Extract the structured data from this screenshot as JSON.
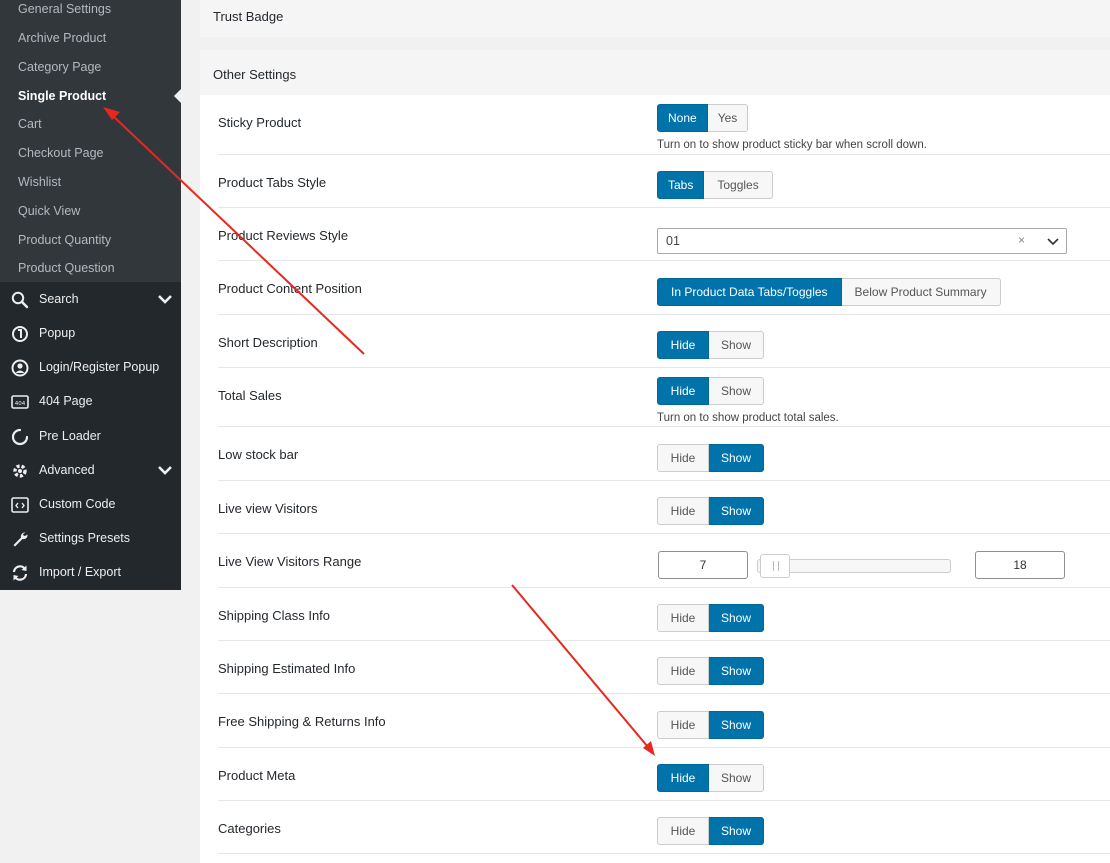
{
  "sidebar": {
    "submenu": [
      "General Settings",
      "Archive Product",
      "Category Page",
      "Single Product",
      "Cart",
      "Checkout Page",
      "Wishlist",
      "Quick View",
      "Product Quantity",
      "Product Question"
    ],
    "current_index": 3,
    "menu": [
      {
        "label": "Search",
        "icon": "search-icon",
        "has_chevron": true
      },
      {
        "label": "Popup",
        "icon": "popup-icon",
        "has_chevron": false
      },
      {
        "label": "Login/Register Popup",
        "icon": "user-circle-icon",
        "has_chevron": false
      },
      {
        "label": "404 Page",
        "icon": "404-icon",
        "has_chevron": false
      },
      {
        "label": "Pre Loader",
        "icon": "spinner-icon",
        "has_chevron": false
      },
      {
        "label": "Advanced",
        "icon": "gear-icon",
        "has_chevron": true
      },
      {
        "label": "Custom Code",
        "icon": "code-icon",
        "has_chevron": false
      },
      {
        "label": "Settings Presets",
        "icon": "wrench-icon",
        "has_chevron": false
      },
      {
        "label": "Import / Export",
        "icon": "sync-icon",
        "has_chevron": false
      }
    ]
  },
  "sections": {
    "trust_badge": "Trust Badge",
    "other_settings": "Other Settings"
  },
  "settings": [
    {
      "label": "Sticky Product",
      "type": "buttons",
      "options": [
        "None",
        "Yes"
      ],
      "active": 0,
      "desc": "Turn on to show product sticky bar when scroll down."
    },
    {
      "label": "Product Tabs Style",
      "type": "buttons",
      "options": [
        "Tabs",
        "Toggles"
      ],
      "active": 0
    },
    {
      "label": "Product Reviews Style",
      "type": "select",
      "value": "01",
      "clear": "×"
    },
    {
      "label": "Product Content Position",
      "type": "buttons",
      "options": [
        "In Product Data Tabs/Toggles",
        "Below Product Summary"
      ],
      "active": 0
    },
    {
      "label": "Short Description",
      "type": "buttons",
      "options": [
        "Hide",
        "Show"
      ],
      "active": 0
    },
    {
      "label": "Total Sales",
      "type": "buttons",
      "options": [
        "Hide",
        "Show"
      ],
      "active": 0,
      "desc": "Turn on to show product total sales."
    },
    {
      "label": "Low stock bar",
      "type": "buttons",
      "options": [
        "Hide",
        "Show"
      ],
      "active": 1
    },
    {
      "label": "Live view Visitors",
      "type": "buttons",
      "options": [
        "Hide",
        "Show"
      ],
      "active": 1
    },
    {
      "label": "Live View Visitors Range",
      "type": "range",
      "min": "7",
      "max": "18"
    },
    {
      "label": "Shipping Class Info",
      "type": "buttons",
      "options": [
        "Hide",
        "Show"
      ],
      "active": 1
    },
    {
      "label": "Shipping Estimated Info",
      "type": "buttons",
      "options": [
        "Hide",
        "Show"
      ],
      "active": 1
    },
    {
      "label": "Free Shipping & Returns Info",
      "type": "buttons",
      "options": [
        "Hide",
        "Show"
      ],
      "active": 1
    },
    {
      "label": "Product Meta",
      "type": "buttons",
      "options": [
        "Hide",
        "Show"
      ],
      "active": 0
    },
    {
      "label": "Categories",
      "type": "buttons",
      "options": [
        "Hide",
        "Show"
      ],
      "active": 1
    }
  ],
  "colors": {
    "accent": "#0073aa",
    "sidebar_bg": "#23282d",
    "submenu_bg": "#32373c",
    "arrow": "#e8281e"
  }
}
